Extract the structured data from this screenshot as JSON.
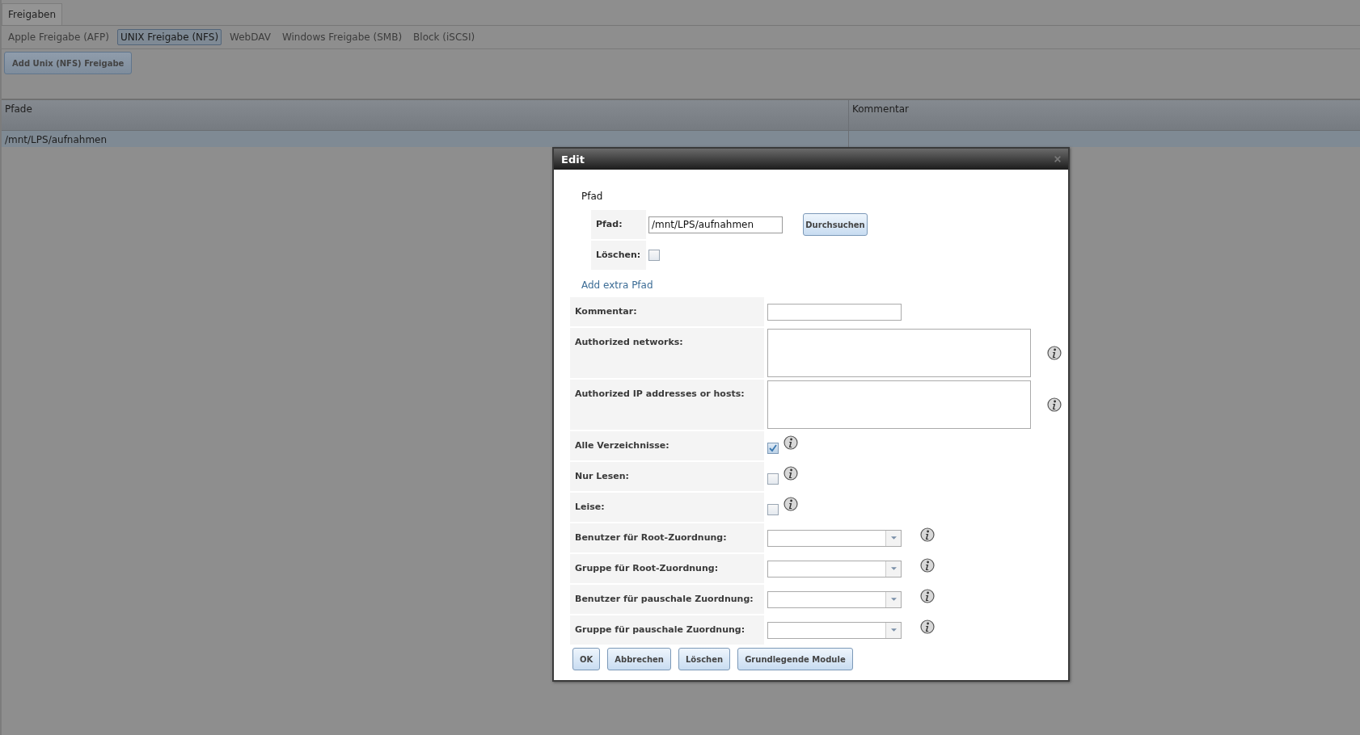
{
  "tabs": [
    {
      "label": "Freigaben",
      "selected": true
    }
  ],
  "subtabs": [
    {
      "label": "Apple Freigabe (AFP)",
      "selected": false
    },
    {
      "label": "UNIX Freigabe (NFS)",
      "selected": true
    },
    {
      "label": "WebDAV",
      "selected": false
    },
    {
      "label": "Windows Freigabe (SMB)",
      "selected": false
    },
    {
      "label": "Block (iSCSI)",
      "selected": false
    }
  ],
  "add_button": "Add Unix (NFS) Freigabe",
  "table": {
    "columns": [
      "Pfade",
      "Kommentar"
    ],
    "rows": [
      {
        "cells": [
          "/mnt/LPS/aufnahmen"
        ],
        "selected": true
      }
    ]
  },
  "dialog": {
    "title": "Edit",
    "section_title": "Pfad",
    "paths": [
      {
        "label": "Pfad:",
        "value": "/mnt/LPS/aufnahmen",
        "browse_button": "Durchsuchen",
        "delete_label": "Löschen:",
        "delete_checked": false
      }
    ],
    "add_path_link": "Add extra Pfad",
    "fields": [
      {
        "kind": "text",
        "label": "Kommentar:",
        "info": false
      },
      {
        "kind": "textarea",
        "label": "Authorized networks:",
        "info": true
      },
      {
        "kind": "textarea",
        "label": "Authorized IP addresses or hosts:",
        "info": true
      },
      {
        "kind": "checkbox",
        "label": "Alle Verzeichnisse:",
        "checked": true,
        "info": true
      },
      {
        "kind": "checkbox",
        "label": "Nur Lesen:",
        "checked": false,
        "info": true
      },
      {
        "kind": "checkbox",
        "label": "Leise:",
        "checked": false,
        "info": true
      },
      {
        "kind": "select",
        "label": "Benutzer für Root-Zuordnung:",
        "info": true
      },
      {
        "kind": "select",
        "label": "Gruppe für Root-Zuordnung:",
        "info": true
      },
      {
        "kind": "select",
        "label": "Benutzer für pauschale Zuordnung:",
        "info": true
      },
      {
        "kind": "select",
        "label": "Gruppe für pauschale Zuordnung:",
        "info": true
      }
    ],
    "buttons": [
      "OK",
      "Abbrechen",
      "Löschen",
      "Grundlegende Module"
    ]
  }
}
